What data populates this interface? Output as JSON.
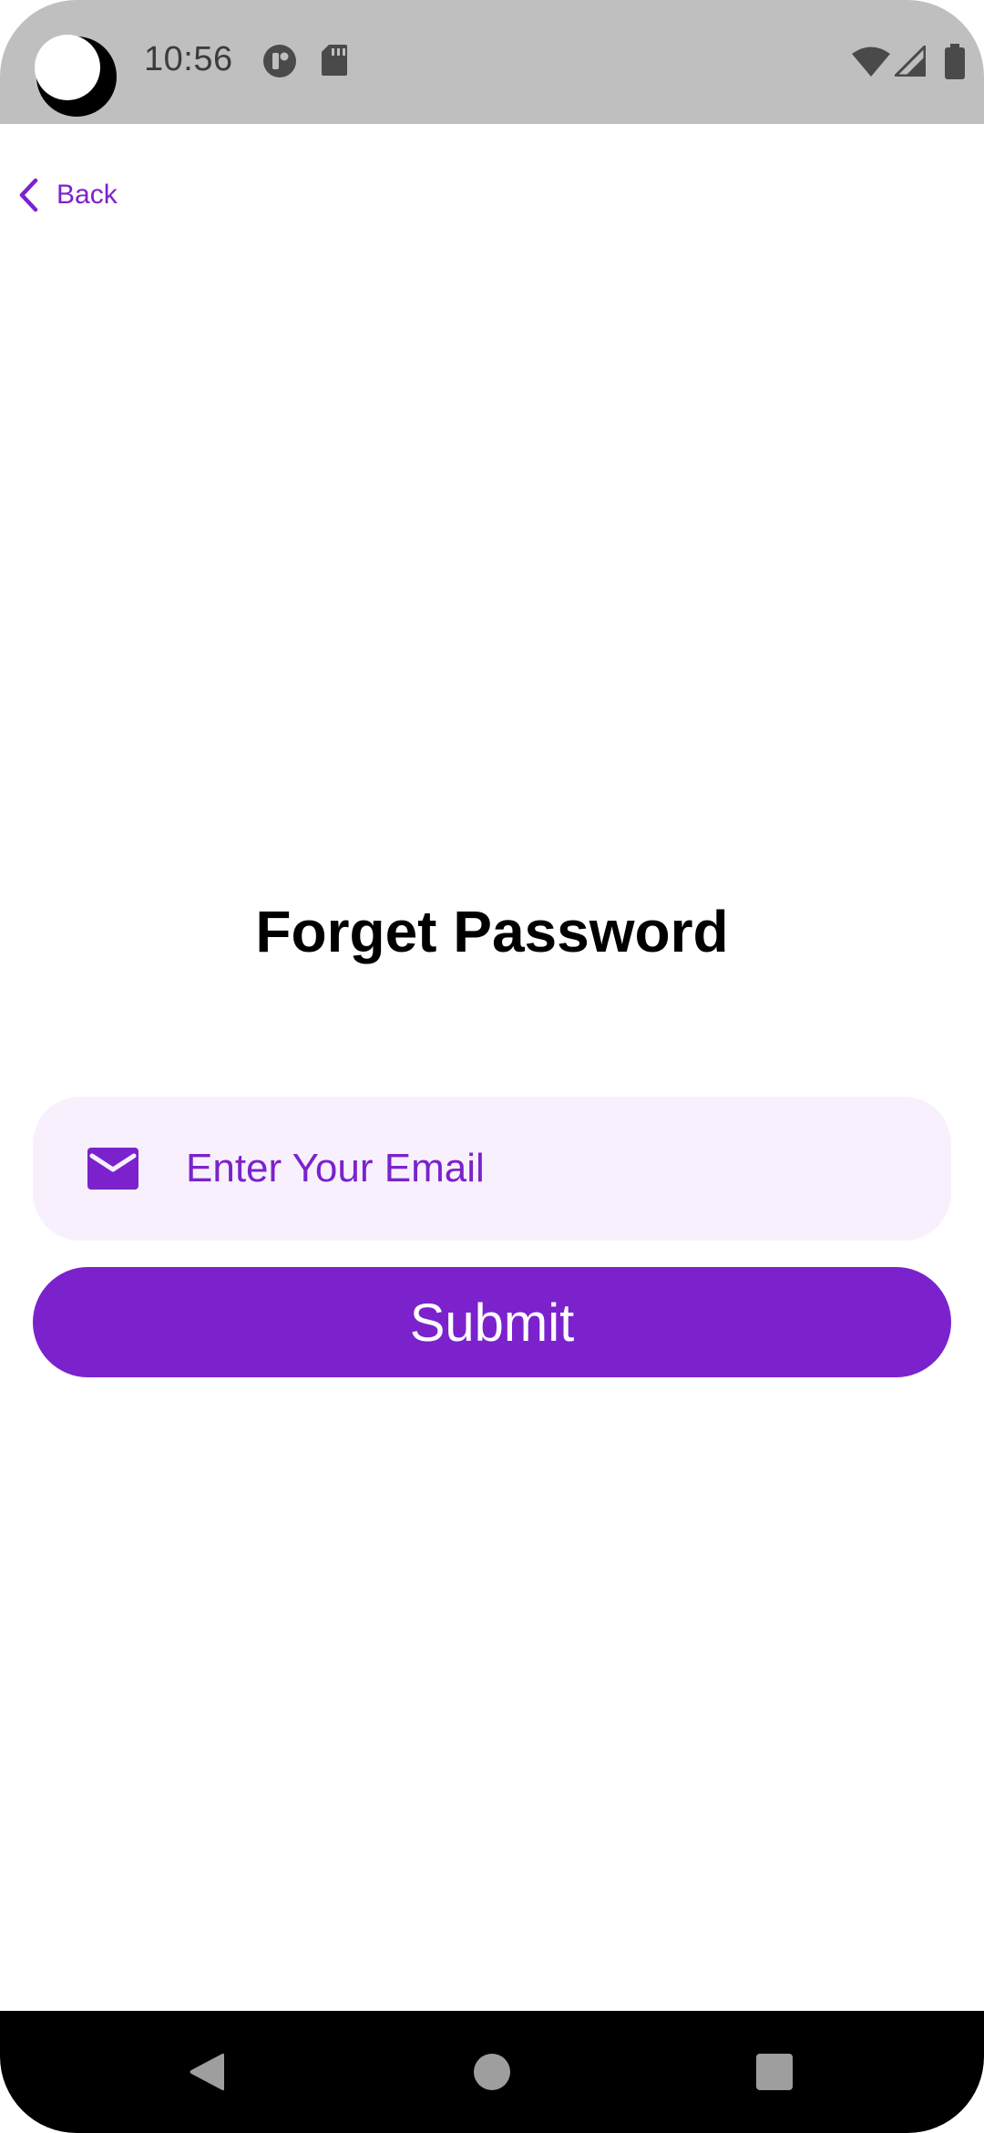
{
  "status_bar": {
    "time": "10:56",
    "icons": [
      "camera-cutout-icon",
      "app-notification-icon",
      "sd-card-icon",
      "wifi-icon",
      "cell-signal-icon",
      "battery-icon"
    ]
  },
  "nav": {
    "back_label": "Back",
    "back_icon": "chevron-left-icon"
  },
  "page": {
    "title": "Forget Password"
  },
  "form": {
    "email_icon": "mail-icon",
    "email_placeholder": "Enter Your Email",
    "email_value": "",
    "submit_label": "Submit"
  },
  "system_nav": {
    "buttons": [
      "back-triangle-icon",
      "home-circle-icon",
      "recents-square-icon"
    ]
  },
  "colors": {
    "accent": "#7b22cd",
    "field_bg": "#f8f1fd",
    "status_bar_bg": "#bfbfbf",
    "nav_bar_bg": "#000000"
  }
}
